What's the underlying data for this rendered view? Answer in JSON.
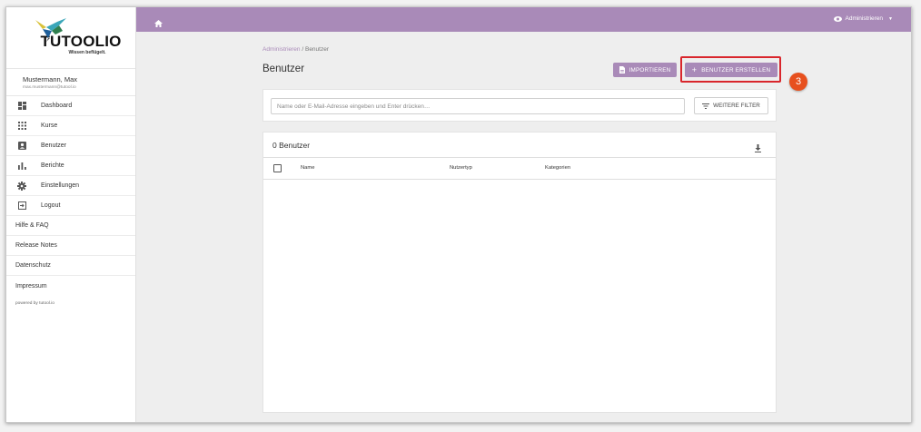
{
  "brand": {
    "name": "TUTOOLIO",
    "tagline": "Wissen beflügelt.",
    "accent": "#a98ab8"
  },
  "user": {
    "name": "Mustermann, Max",
    "email": "max.mustermann@tutool.io"
  },
  "sidebar": {
    "items": [
      {
        "label": "Dashboard",
        "icon": "dashboard-icon"
      },
      {
        "label": "Kurse",
        "icon": "grid-icon"
      },
      {
        "label": "Benutzer",
        "icon": "user-box-icon"
      },
      {
        "label": "Berichte",
        "icon": "bar-chart-icon"
      },
      {
        "label": "Einstellungen",
        "icon": "gear-icon"
      },
      {
        "label": "Logout",
        "icon": "logout-icon"
      }
    ],
    "links": [
      "Hilfe & FAQ",
      "Release Notes",
      "Datenschutz",
      "Impressum"
    ],
    "powered": "powered by tutool.io"
  },
  "topbar": {
    "admin_label": "Administrieren",
    "home_icon": "home-icon"
  },
  "breadcrumb": {
    "parent": "Administrieren",
    "separator": "/",
    "current": "Benutzer"
  },
  "page": {
    "title": "Benutzer"
  },
  "actions": {
    "import_label": "IMPORTIEREN",
    "create_label": "BENUTZER ERSTELLEN"
  },
  "annotation": {
    "step": "3",
    "highlight_color": "#d9262c",
    "badge_color": "#e7501e"
  },
  "filter": {
    "placeholder": "Name oder E-Mail-Adresse eingeben und Enter drücken…",
    "more_label": "WEITERE FILTER"
  },
  "table": {
    "count_label": "0 Benutzer",
    "columns": [
      "Name",
      "Nutzertyp",
      "Kategorien"
    ]
  }
}
